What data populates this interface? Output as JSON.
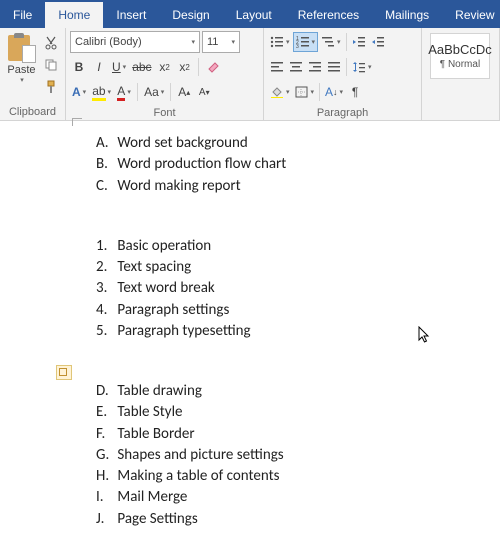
{
  "tabs": {
    "file": "File",
    "home": "Home",
    "insert": "Insert",
    "design": "Design",
    "layout": "Layout",
    "references": "References",
    "mailings": "Mailings",
    "review": "Review"
  },
  "ribbon": {
    "clipboard": {
      "label": "Clipboard",
      "paste": "Paste"
    },
    "font": {
      "label": "Font",
      "name": "Calibri (Body)",
      "size": "11"
    },
    "paragraph": {
      "label": "Paragraph"
    },
    "styles": {
      "preview": "AaBbCcDc",
      "name": "¶ Normal"
    }
  },
  "doc": {
    "listA": [
      {
        "lbl": "A.",
        "text": "Word set background"
      },
      {
        "lbl": "B.",
        "text": "Word production flow chart"
      },
      {
        "lbl": "C.",
        "text": "Word making report"
      }
    ],
    "listB": [
      {
        "lbl": "1.",
        "text": "Basic operation"
      },
      {
        "lbl": "2.",
        "text": "Text spacing"
      },
      {
        "lbl": "3.",
        "text": "Text word break"
      },
      {
        "lbl": "4.",
        "text": "Paragraph settings"
      },
      {
        "lbl": "5.",
        "text": "Paragraph typesetting"
      }
    ],
    "listC": [
      {
        "lbl": "D.",
        "text": "Table drawing"
      },
      {
        "lbl": "E.",
        "text": "Table Style"
      },
      {
        "lbl": "F.",
        "text": "Table Border"
      },
      {
        "lbl": "G.",
        "text": "Shapes and picture settings"
      },
      {
        "lbl": "H.",
        "text": "Making a table of contents"
      },
      {
        "lbl": "I.",
        "text": "Mail Merge"
      },
      {
        "lbl": "J.",
        "text": "Page Settings"
      }
    ]
  }
}
